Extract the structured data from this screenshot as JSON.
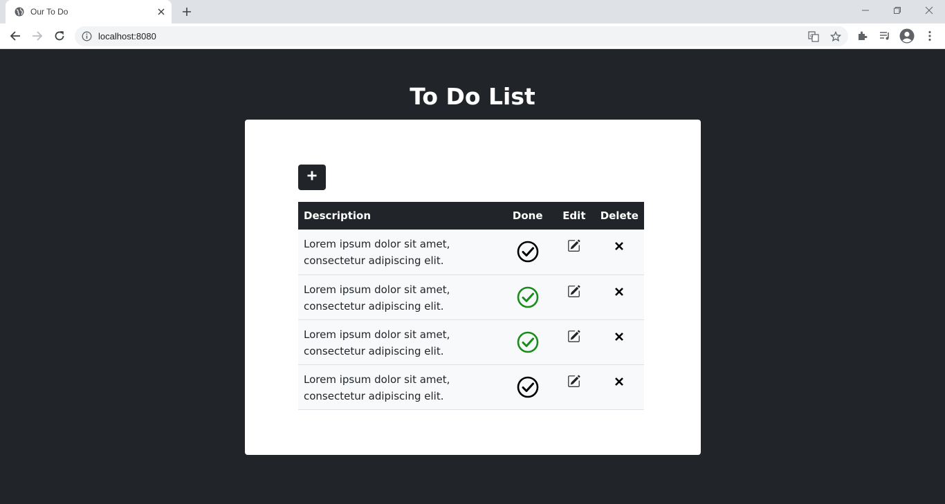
{
  "browser": {
    "tab_title": "Our To Do",
    "url": "localhost:8080"
  },
  "page": {
    "title": "To Do List"
  },
  "table": {
    "headers": {
      "description": "Description",
      "done": "Done",
      "edit": "Edit",
      "delete": "Delete"
    },
    "rows": [
      {
        "description": "Lorem ipsum dolor sit amet, consectetur adipiscing elit.",
        "done": false
      },
      {
        "description": "Lorem ipsum dolor sit amet, consectetur adipiscing elit.",
        "done": true
      },
      {
        "description": "Lorem ipsum dolor sit amet, consectetur adipiscing elit.",
        "done": true
      },
      {
        "description": "Lorem ipsum dolor sit amet, consectetur adipiscing elit.",
        "done": false
      }
    ]
  },
  "colors": {
    "page_bg": "#212529",
    "done_color": "#198c19",
    "not_done_color": "#000000"
  },
  "icons": {
    "add": "plus-icon",
    "done": "check-circle-icon",
    "edit": "pencil-square-icon",
    "delete": "x-icon"
  }
}
